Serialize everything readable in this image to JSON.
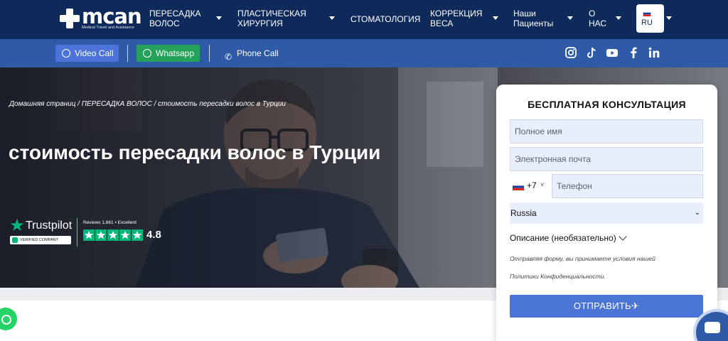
{
  "nav": {
    "logo_text": "mcan",
    "logo_tagline": "Medical Travel and Assistance",
    "items": [
      {
        "line1": "ПЕРЕСАДКА",
        "line2": "ВОЛОС"
      },
      {
        "line1": "ПЛАСТИЧЕСКАЯ",
        "line2": "ХИРУРГИЯ"
      },
      {
        "line1": "СТОМАТОЛОГИЯ",
        "line2": ""
      },
      {
        "line1": "КОРРЕКЦИЯ",
        "line2": "ВЕСА"
      },
      {
        "line1": "Наши",
        "line2": "Пациенты"
      },
      {
        "line1": "О",
        "line2": "НАС"
      }
    ],
    "language": "RU"
  },
  "contact": {
    "video_call": "Video Call",
    "whatsapp": "Whatsapp",
    "phone_call": "Phone Call",
    "social_icons": [
      "instagram-icon",
      "tiktok-icon",
      "youtube-icon",
      "facebook-icon",
      "linkedin-icon"
    ]
  },
  "hero": {
    "breadcrumb": "Домашняя страниц / ПЕРЕСАДКА ВОЛОС / стоимость пересадки волос в Турции",
    "title": "стоимость пересадки волос в Турции"
  },
  "trustpilot": {
    "name": "Trustpilot",
    "verified": "VERIFIED COMPANY",
    "reviews": "Reviews 1,661  •  Excellent",
    "rating": "4.8",
    "stars": 5
  },
  "form": {
    "title": "БЕСПЛАТНАЯ КОНСУЛЬТАЦИЯ",
    "name_placeholder": "Полное имя",
    "email_placeholder": "Электронная почта",
    "phone_code": "+7",
    "phone_placeholder": "Телефон",
    "country": "Russia",
    "description_label": "Описание (необязательно)",
    "note_line1": "Отправляя форму, вы принимаете условия нашей",
    "note_line2": "Политики Конфиденциальности.",
    "submit": "ОТПРАВИТЬ"
  },
  "colors": {
    "nav_bg": "#0d2a5a",
    "contact_bar": "#2e5aa8",
    "video_button": "#4b73d8",
    "whatsapp_button": "#25a25a",
    "submit_button": "#4a74d6",
    "trustpilot_green": "#00b67a"
  }
}
